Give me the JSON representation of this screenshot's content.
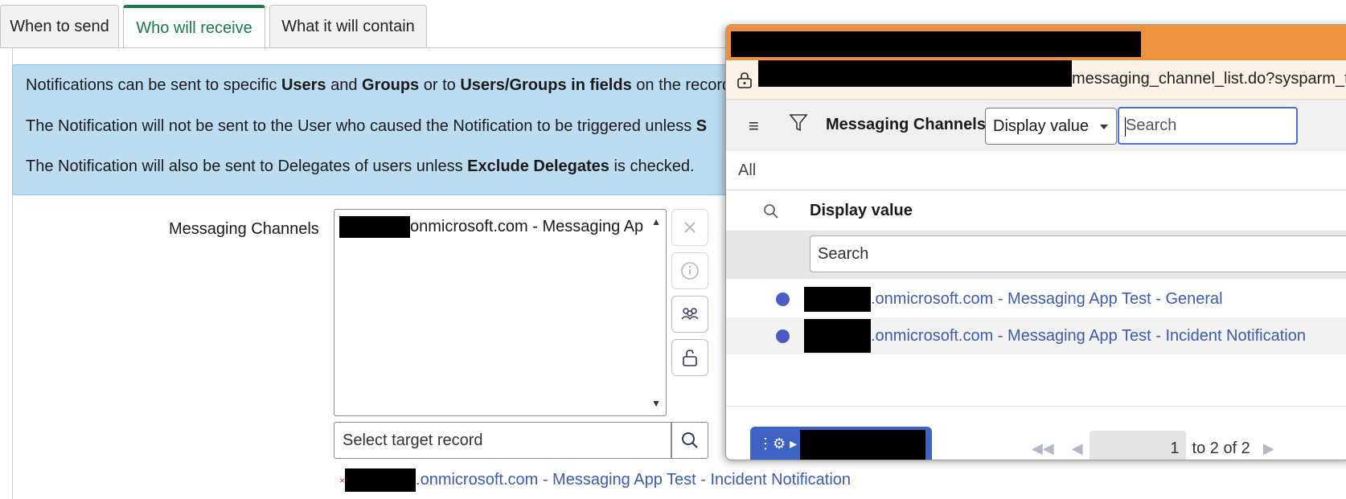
{
  "tabs": [
    {
      "label": "When to send",
      "active": false
    },
    {
      "label": "Who will receive",
      "active": true
    },
    {
      "label": "What it will contain",
      "active": false
    }
  ],
  "info": {
    "line1": {
      "t1": "Notifications can be sent to specific ",
      "b1": "Users",
      "t2": " and ",
      "b2": "Groups",
      "t3": " or to ",
      "b3": "Users/Groups in fields",
      "t4": " on the record"
    },
    "line2": {
      "t1": "The Notification will not be sent to the User who caused the Notification to be triggered unless ",
      "b1": "S"
    },
    "line3": {
      "t1": "The Notification will also be sent to Delegates of users unless ",
      "b1": "Exclude Delegates",
      "t2": " is checked."
    }
  },
  "field": {
    "label": "Messaging Channels",
    "selected_option": "onmicrosoft.com - Messaging Ap",
    "target_placeholder": "Select target record",
    "target_value": ".onmicrosoft.com - Messaging App Test - Incident Notification",
    "remove_mark": "×"
  },
  "icons": {
    "clear": "close-icon",
    "info": "info-icon",
    "group": "group-icon",
    "unlock": "unlock-icon",
    "search": "search-icon"
  },
  "popup": {
    "url_suffix": "messaging_channel_list.do?sysparm_t",
    "list_title": "Messaging Channels",
    "field_select": "Display value",
    "search_placeholder": "Search",
    "breadcrumb": "All",
    "column": "Display value",
    "column_filter_placeholder": "Search",
    "rows": [
      {
        "display": ".onmicrosoft.com - Messaging App Test - General"
      },
      {
        "display": ".onmicrosoft.com - Messaging App Test - Incident Notification"
      }
    ],
    "pager": {
      "current": "1",
      "range": "to 2 of 2"
    }
  },
  "colors": {
    "active_tab": "#1b7a4a",
    "info_bg": "#bcdcf2",
    "titlebar": "#ef903c",
    "link": "#3b5bb5",
    "context_btn": "#3e63c4"
  }
}
